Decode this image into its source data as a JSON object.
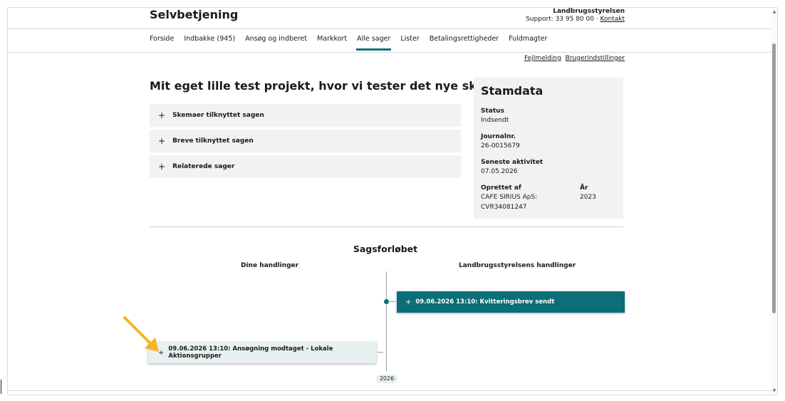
{
  "header": {
    "brand": "Selvbetjening",
    "org_name": "Landbrugsstyrelsen",
    "support_text": "Support: 33 95 80 00 · ",
    "contact_link": "Kontakt"
  },
  "nav": {
    "tabs": [
      {
        "label": "Forside"
      },
      {
        "label": "Indbakke (945)"
      },
      {
        "label": "Ansøg og indberet"
      },
      {
        "label": "Markkort"
      },
      {
        "label": "Alle sager",
        "active": true
      },
      {
        "label": "Lister"
      },
      {
        "label": "Betalingsrettigheder"
      },
      {
        "label": "Fuldmagter"
      }
    ]
  },
  "utility": {
    "error_report": "Fejlmelding",
    "user_settings": "Brugerindstillinger"
  },
  "case": {
    "title": "Mit eget lille test projekt, hvor vi tester det nye skema.",
    "accordions": [
      {
        "label": "Skemaer tilknyttet sagen"
      },
      {
        "label": "Breve tilknyttet sagen"
      },
      {
        "label": "Relaterede sager"
      }
    ]
  },
  "stamdata": {
    "title": "Stamdata",
    "status_label": "Status",
    "status_value": "Indsendt",
    "journal_label": "Journalnr.",
    "journal_value": "26-0015679",
    "activity_label": "Seneste aktivitet",
    "activity_value": "07.05.2026",
    "created_label": "Oprettet af",
    "created_value_1": "CAFE SIRIUS ApS:",
    "created_value_2": "CVR34081247",
    "year_label": "År",
    "year_value": "2023"
  },
  "timeline": {
    "title": "Sagsforløbet",
    "left_heading": "Dine handlinger",
    "right_heading": "Landbrugsstyrelsens handlinger",
    "events_right": [
      {
        "label": "09.06.2026 13:10: Kvitteringsbrev sendt"
      }
    ],
    "events_left": [
      {
        "label": "09.06.2026 13:10: Ansøgning modtaget - Lokale Aktionsgrupper"
      }
    ],
    "year": "2026"
  },
  "colors": {
    "accent": "#0b6e78",
    "event_light": "#e8f1f2",
    "panel_bg": "#f2f2f2",
    "arrow": "#f5b324"
  }
}
